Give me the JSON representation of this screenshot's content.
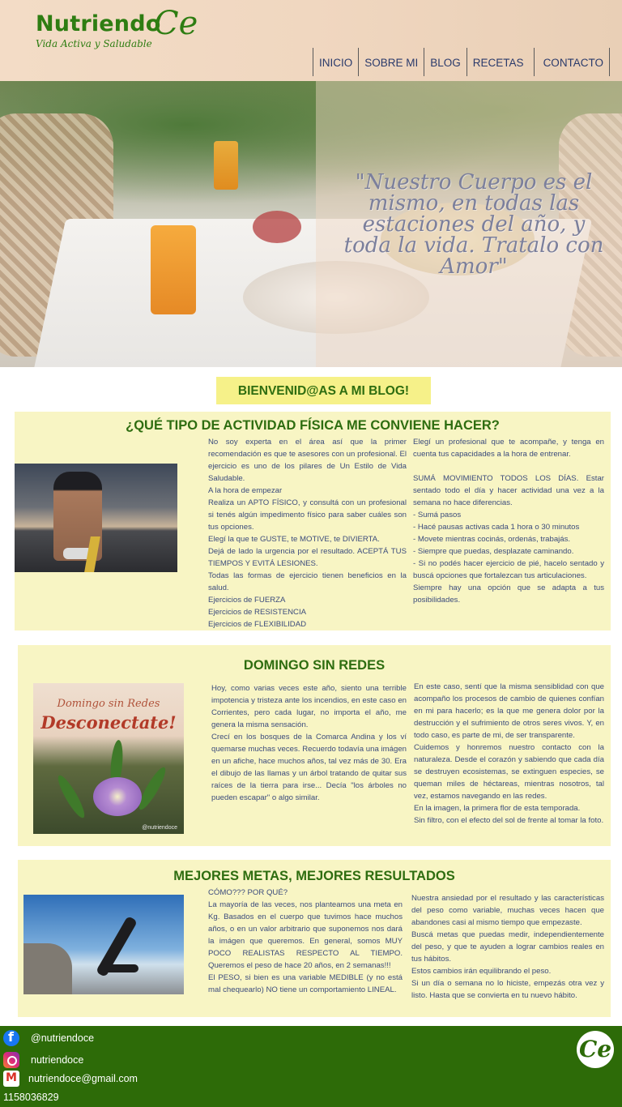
{
  "header": {
    "logo_main": "Nutriendo",
    "logo_ce": "Ce",
    "logo_sub": "Vida Activa y Saludable",
    "nav": [
      "INICIO",
      "SOBRE MI",
      "BLOG",
      "RECETAS",
      "CONTACTO"
    ]
  },
  "hero": {
    "quote": "\"Nuestro Cuerpo es el mismo, en todas las estaciones del año, y toda la vida. Tratalo con Amor\""
  },
  "welcome": "BIENVENID@AS A MI BLOG!",
  "posts": [
    {
      "title": "¿QUÉ TIPO DE ACTIVIDAD FÍSICA ME CONVIENE HACER?",
      "col1": [
        "No soy experta en el área así que la primer recomendación es que te asesores con un profesional. El ejercicio es uno de los pilares de Un Estilo de Vida Saludable.",
        "A la hora de empezar",
        "Realiza un APTO FÍSICO, y consultá con un profesional si tenés algún impedimento físico para saber cuáles son tus opciones.",
        "Elegí la que te GUSTE, te MOTIVE, te DIVIERTA.",
        "Dejá de lado la urgencia por el resultado. ACEPTÁ TUS TIEMPOS Y EVITÁ LESIONES.",
        "Todas las formas de ejercicio tienen beneficios en la salud.",
        "Ejercicios de FUERZA",
        "Ejercicios de RESISTENCIA",
        "Ejercicios de FLEXIBILIDAD"
      ],
      "col2": [
        "Elegí un profesional que te acompañe, y tenga en cuenta tus capacidades a la hora de entrenar.",
        " ",
        "SUMÁ MOVIMIENTO TODOS LOS DÍAS. Estar sentado todo el día y hacer actividad una vez a la semana no hace diferencias.",
        "- Sumá pasos",
        "- Hacé pausas activas cada 1 hora o 30 minutos",
        "- Movete mientras cocinás, ordenás, trabajás.",
        "- Siempre que puedas, desplazate caminando.",
        "- Si no podés hacer ejercicio de pié, hacelo sentado y buscá opciones que fortalezcan tus articulaciones.",
        "Siempre hay una opción que se adapta a tus posibilidades."
      ]
    },
    {
      "title": "DOMINGO SIN REDES",
      "image_title": "Domingo sin Redes",
      "image_subtitle": "Desconectate!",
      "image_watermark": "@nutriendoce",
      "col1": [
        "Hoy, como varias veces este año, siento una terrible impotencia y tristeza ante los incendios, en este caso en Corrientes, pero cada lugar, no importa el año, me genera la misma sensación.",
        "Crecí en los bosques de la Comarca Andina y los ví quemarse muchas veces. Recuerdo todavía una imágen en un afiche, hace muchos años, tal vez más de 30. Era el dibujo de las llamas y un árbol tratando de quitar sus raíces de la tierra para irse... Decía \"los árboles no pueden escapar\" o algo similar."
      ],
      "col2": [
        "En este caso, sentí que la misma sensiblidad con que acompaño los procesos de cambio de quienes confían en mi para hacerlo; es la que me genera dolor por la destrucción y el sufrimiento de otros seres vivos. Y, en todo caso, es parte de mi, de ser transparente.",
        "Cuidemos y honremos nuestro contacto con la naturaleza. Desde el corazón y sabiendo que cada día se destruyen ecosistemas, se extinguen especies, se queman miles de héctareas, mientras nosotros, tal vez, estamos navegando en las redes.",
        "En la imagen, la primera flor de esta temporada.",
        "Sin filtro, con el efecto del sol de frente al tomar la foto."
      ]
    },
    {
      "title": "MEJORES METAS, MEJORES RESULTADOS",
      "col1": [
        "CÓMO??? POR QUÉ?",
        "La mayoría de las veces, nos planteamos una meta en Kg. Basados en el cuerpo que tuvimos hace muchos años, o en un valor arbitrario que suponemos nos dará la imágen que queremos. En general, somos MUY POCO REALISTAS RESPECTO AL TIEMPO. Queremos el peso de hace 20 años, en 2 semanas!!!",
        "El PESO, si bien es una variable MEDIBLE (y no está mal chequearlo) NO tiene un comportamiento LINEAL."
      ],
      "col2": [
        "Nuestra ansiedad por el resultado y las características del peso como variable, muchas veces hacen que abandones casi al mismo tiempo que empezaste.",
        "Buscá metas que puedas medir, independientemente del peso, y que te ayuden a lograr cambios reales en tus hábitos.",
        "Estos cambios irán equilibrando el peso.",
        "Si un día o semana no lo hiciste, empezás otra vez y listo. Hasta que se convierta en tu nuevo hábito."
      ]
    }
  ],
  "footer": {
    "facebook": "@nutriendoce",
    "instagram": "nutriendoce",
    "email": "nutriendoce@gmail.com",
    "phone": "1158036829",
    "badge": "Ce"
  }
}
